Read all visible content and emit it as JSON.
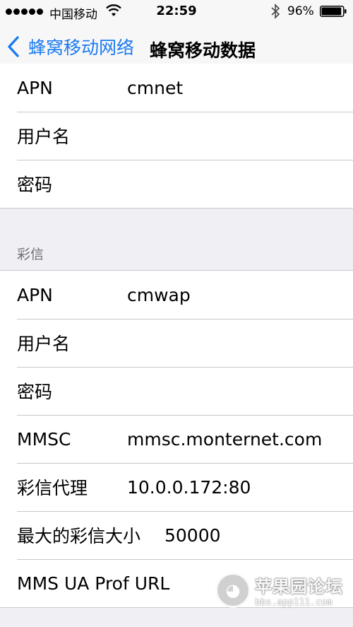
{
  "status_bar": {
    "carrier": "中国移动",
    "time": "22:59",
    "battery_percent": "96%",
    "signal_bars": 5,
    "battery_level": 0.96
  },
  "nav": {
    "back_label": "蜂窝移动网络",
    "title": "蜂窝移动数据"
  },
  "cellular_data": {
    "rows": [
      {
        "label": "APN",
        "value": "cmnet"
      },
      {
        "label": "用户名",
        "value": ""
      },
      {
        "label": "密码",
        "value": ""
      }
    ]
  },
  "mms": {
    "header": "彩信",
    "rows": [
      {
        "label": "APN",
        "value": "cmwap"
      },
      {
        "label": "用户名",
        "value": ""
      },
      {
        "label": "密码",
        "value": ""
      },
      {
        "label": "MMSC",
        "value": "mmsc.monternet.com"
      },
      {
        "label": "彩信代理",
        "value": "10.0.0.172:80"
      },
      {
        "label": "最大的彩信大小",
        "value": "50000"
      },
      {
        "label": "MMS UA Prof URL",
        "value": ""
      }
    ]
  },
  "watermark": {
    "name": "苹果园论坛",
    "url": "bbs.app111.com"
  },
  "colors": {
    "accent": "#1a7af0",
    "background": "#efeff4",
    "separator": "#c8c7cc"
  }
}
